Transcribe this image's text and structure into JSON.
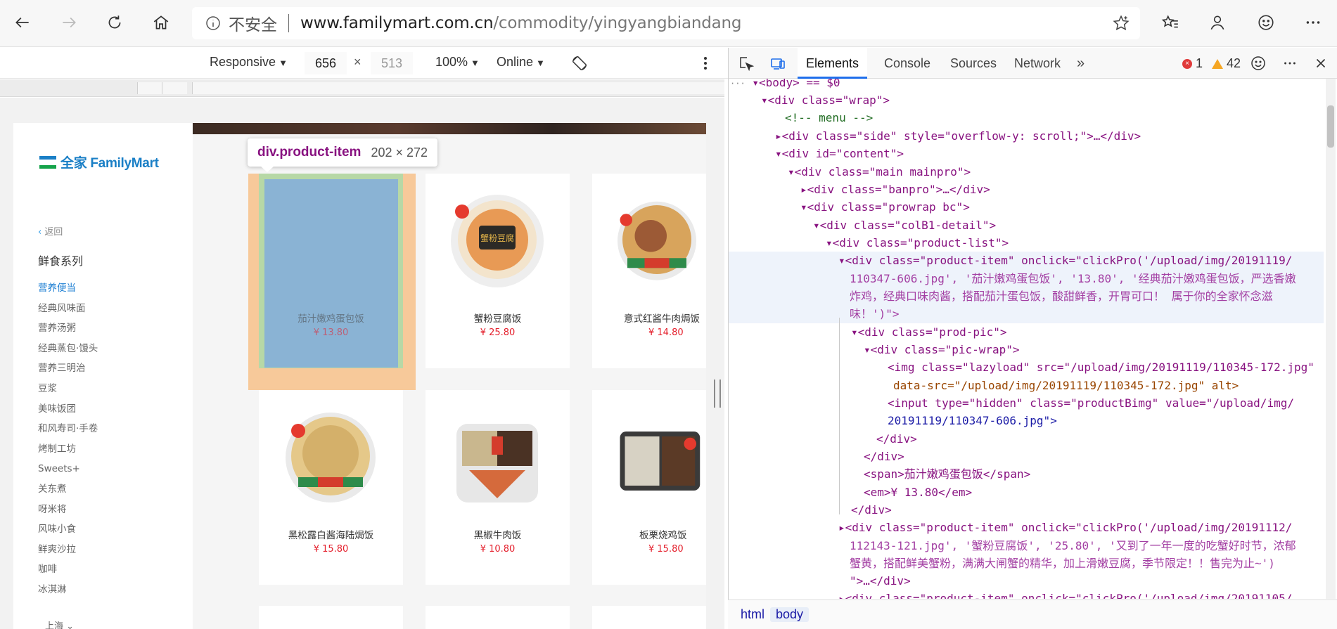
{
  "browser": {
    "security_label": "不安全",
    "url_host": "www.familymart.com.cn",
    "url_path": "/commodity/yingyangbiandang"
  },
  "device_toolbar": {
    "mode": "Responsive",
    "width": "656",
    "height": "513",
    "zoom": "100%",
    "network": "Online"
  },
  "site": {
    "logo_text": "全家 FamilyMart",
    "back_label": "返回",
    "back_glyph": "‹",
    "section_title": "鲜食系列",
    "menu": [
      {
        "label": "营养便当",
        "active": true
      },
      {
        "label": "经典风味面",
        "active": false
      },
      {
        "label": "营养汤粥",
        "active": false
      },
      {
        "label": "经典蒸包·馒头",
        "active": false
      },
      {
        "label": "营养三明治",
        "active": false
      },
      {
        "label": "豆浆",
        "active": false
      },
      {
        "label": "美味饭团",
        "active": false
      },
      {
        "label": "和风寿司·手卷",
        "active": false
      },
      {
        "label": "烤制工坊",
        "active": false
      },
      {
        "label": "Sweets+",
        "active": false
      },
      {
        "label": "关东煮",
        "active": false
      },
      {
        "label": "呀米将",
        "active": false
      },
      {
        "label": "风味小食",
        "active": false
      },
      {
        "label": "鲜爽沙拉",
        "active": false
      },
      {
        "label": "咖啡",
        "active": false
      },
      {
        "label": "冰淇淋",
        "active": false
      }
    ],
    "city": "上海"
  },
  "products": [
    {
      "name": "茄汁嫩鸡蛋包饭",
      "price": "¥ 13.80"
    },
    {
      "name": "蟹粉豆腐饭",
      "price": "¥ 25.80"
    },
    {
      "name": "意式红酱牛肉焗饭",
      "price": "¥ 14.80"
    },
    {
      "name": "黑松露白酱海陆焗饭",
      "price": "¥ 15.80"
    },
    {
      "name": "黑椒牛肉饭",
      "price": "¥ 10.80"
    },
    {
      "name": "板栗烧鸡饭",
      "price": "¥ 15.80"
    }
  ],
  "inspector_tooltip": {
    "selector": "div.product-item",
    "size": "202 × 272"
  },
  "devtools": {
    "tabs": [
      "Elements",
      "Console",
      "Sources",
      "Network"
    ],
    "active_tab": "Elements",
    "more_glyph": "»",
    "errors": "1",
    "warnings": "42",
    "breadcrumbs": [
      "html",
      "body"
    ],
    "dom_lines": [
      "▾<body> == $0",
      "▾<div class=\"wrap\">",
      "<!-- menu -->",
      "▸<div class=\"side\" style=\"overflow-y: scroll;\">…</div>",
      "▾<div id=\"content\">",
      "▾<div class=\"main mainpro\">",
      "▸<div class=\"banpro\">…</div>",
      "▾<div class=\"prowrap bc\">",
      "▾<div class=\"colB1-detail\">",
      "▾<div class=\"product-list\">",
      "▾<div class=\"product-item\" onclick=\"clickPro('/upload/img/20191119/",
      "110347-606.jpg', '茄汁嫩鸡蛋包饭', '13.80', '经典茄汁嫩鸡蛋包饭，严选香嫩",
      "炸鸡，经典口味肉酱，搭配茄汁蛋包饭，酸甜鲜香，开胃可口！ 属于你的全家怀念滋",
      "味！')\">",
      "▾<div class=\"prod-pic\">",
      "▾<div class=\"pic-wrap\">",
      "<img class=\"lazyload\" src=\"/upload/img/20191119/110345-172.jpg\"",
      "data-src=\"/upload/img/20191119/110345-172.jpg\" alt>",
      "<input type=\"hidden\" class=\"productBimg\" value=\"/upload/img/",
      "20191119/110347-606.jpg\">",
      "</div>",
      "</div>",
      "<span>茄汁嫩鸡蛋包饭</span>",
      "<em>¥ 13.80</em>",
      "</div>",
      "▸<div class=\"product-item\" onclick=\"clickPro('/upload/img/20191112/",
      "112143-121.jpg', '蟹粉豆腐饭', '25.80', '又到了一年一度的吃蟹好时节，浓郁",
      "蟹黄，搭配鲜美蟹粉，满满大闸蟹的精华，加上滑嫩豆腐，季节限定！！售完为止~')",
      "\">…</div>",
      "▸<div class=\"product-item\" onclick=\"clickPro('/upload/img/20191105/"
    ]
  },
  "colors": {
    "accent_blue": "#1f6feb",
    "price_red": "#e41e2b",
    "familymart_blue": "#1a7fc6",
    "familymart_green": "#15a34a"
  }
}
